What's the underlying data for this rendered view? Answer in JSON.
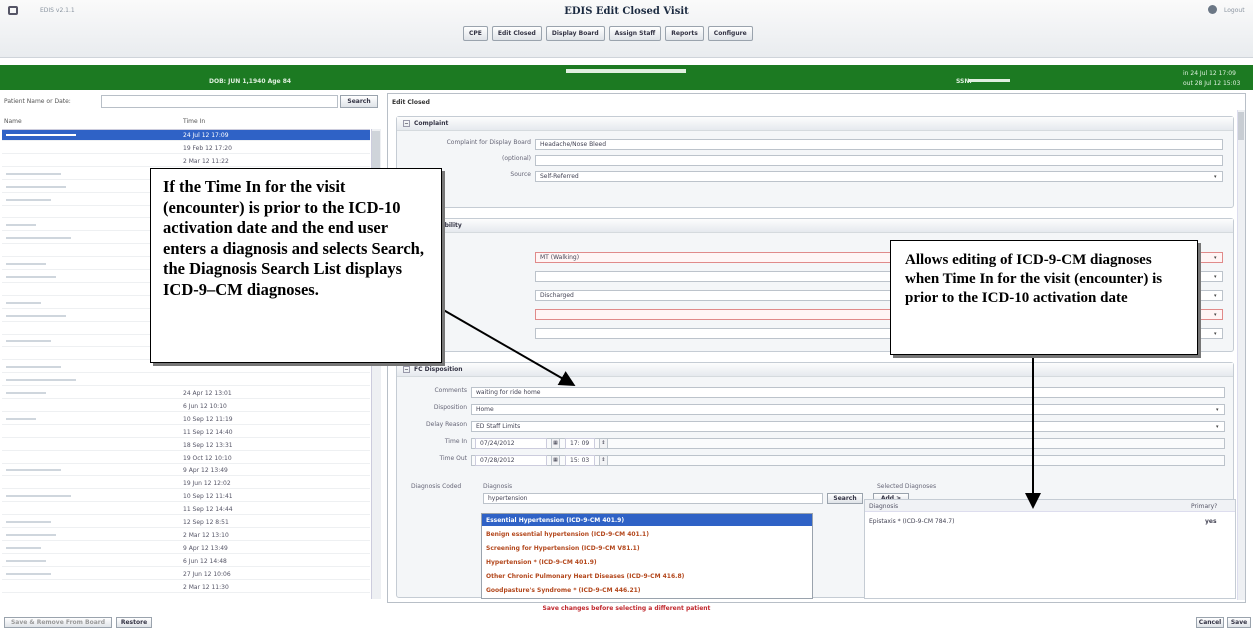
{
  "app": {
    "version": "EDIS v2.1.1",
    "title": "EDIS Edit Closed Visit",
    "logout": "Logout"
  },
  "toolbar": [
    "CPE",
    "Edit Closed",
    "Display Board",
    "Assign Staff",
    "Reports",
    "Configure"
  ],
  "banner": {
    "dob": "DOB: JUN 1,1940  Age 84",
    "ssn_label": "SSN:",
    "datetime1": "in 24 Jul 12 17:09",
    "datetime2": "out 28 Jul 12 15:03"
  },
  "left": {
    "search_label": "Patient Name or Date:",
    "search_button": "Search",
    "col_name": "Name",
    "col_time": "Time In",
    "rows": [
      {
        "time": "24 Jul 12 17:09",
        "selected": true
      },
      {
        "time": "19 Feb 12 17:20"
      },
      {
        "time": "2 Mar 12 11:22"
      },
      {
        "time": ""
      },
      {
        "time": ""
      },
      {
        "time": ""
      },
      {
        "time": ""
      },
      {
        "time": ""
      },
      {
        "time": ""
      },
      {
        "time": ""
      },
      {
        "time": ""
      },
      {
        "time": ""
      },
      {
        "time": ""
      },
      {
        "time": ""
      },
      {
        "time": ""
      },
      {
        "time": ""
      },
      {
        "time": ""
      },
      {
        "time": ""
      },
      {
        "time": ""
      },
      {
        "time": ""
      },
      {
        "time": "24 Apr 12 13:01"
      },
      {
        "time": "6 Jun 12 10:10"
      },
      {
        "time": "10 Sep 12 11:19"
      },
      {
        "time": "11 Sep 12 14:40"
      },
      {
        "time": "18 Sep 12 13:31"
      },
      {
        "time": "19 Oct 12 10:10"
      },
      {
        "time": "9 Apr 12 13:49"
      },
      {
        "time": "19 Jun 12 12:02"
      },
      {
        "time": "10 Sep 12 11:41"
      },
      {
        "time": "11 Sep 12 14:44"
      },
      {
        "time": "12 Sep 12 8:51"
      },
      {
        "time": "2 Mar 12 13:10"
      },
      {
        "time": "9 Apr 12 13:49"
      },
      {
        "time": "6 Jun 12 14:48"
      },
      {
        "time": "27 Jun 12 10:06"
      },
      {
        "time": "2 Mar 12 11:30"
      }
    ]
  },
  "right": {
    "title": "Edit Closed",
    "complaint": {
      "header": "Complaint",
      "display_label": "Complaint for Display Board",
      "display_value": "Headache/Nose Bleed",
      "optional_label": "(optional)",
      "source_label": "Source",
      "source_value": "Self-Referred"
    },
    "responsibility": {
      "header": "Responsibility",
      "row1": "MT  (Walking)",
      "row3": "Discharged"
    },
    "disposition": {
      "header": "FC Disposition",
      "comments_label": "Comments",
      "comments_value": "waiting for ride home",
      "disposition_label": "Disposition",
      "disposition_value": "Home",
      "delay_label": "Delay Reason",
      "delay_value": "ED Staff Limits",
      "time_in_label": "Time In",
      "time_in_date": "07/24/2012",
      "time_in_time": "17: 09",
      "time_out_label": "Time Out",
      "time_out_date": "07/28/2012",
      "time_out_time": "15: 03",
      "dx_coded_label": "Diagnosis Coded",
      "dx_label": "Diagnosis",
      "dx_input": "hypertension",
      "search_button": "Search",
      "add_button": "Add >",
      "dx_options": [
        "Essential Hypertension (ICD-9-CM 401.9)",
        "Benign essential hypertension (ICD-9-CM 401.1)",
        "Screening for Hypertension (ICD-9-CM V81.1)",
        "Hypertension * (ICD-9-CM 401.9)",
        "Other Chronic Pulmonary Heart Diseases (ICD-9-CM 416.8)",
        "Goodpasture's Syndrome * (ICD-9-CM 446.21)"
      ],
      "selected_header": "Selected Diagnoses",
      "selected_col_dx": "Diagnosis",
      "selected_col_primary": "Primary?",
      "selected_rows": [
        {
          "dx": "Epistaxis * (ICD-9-CM 784.7)",
          "primary": "yes"
        }
      ]
    }
  },
  "footer": {
    "message": "Save changes before selecting a different patient",
    "left_button1": "Save & Remove From Board",
    "left_button2": "Restore",
    "cancel": "Cancel",
    "save": "Save"
  },
  "callouts": {
    "c1": "If the Time In for the visit (encounter) is prior to the ICD-10 activation date and the end user enters a diagnosis and selects Search, the Diagnosis Search List displays ICD-9–CM diagnoses.",
    "c2": "Allows editing of ICD-9-CM diagnoses when Time In for the visit (encounter) is prior to the ICD-10 activation date"
  }
}
